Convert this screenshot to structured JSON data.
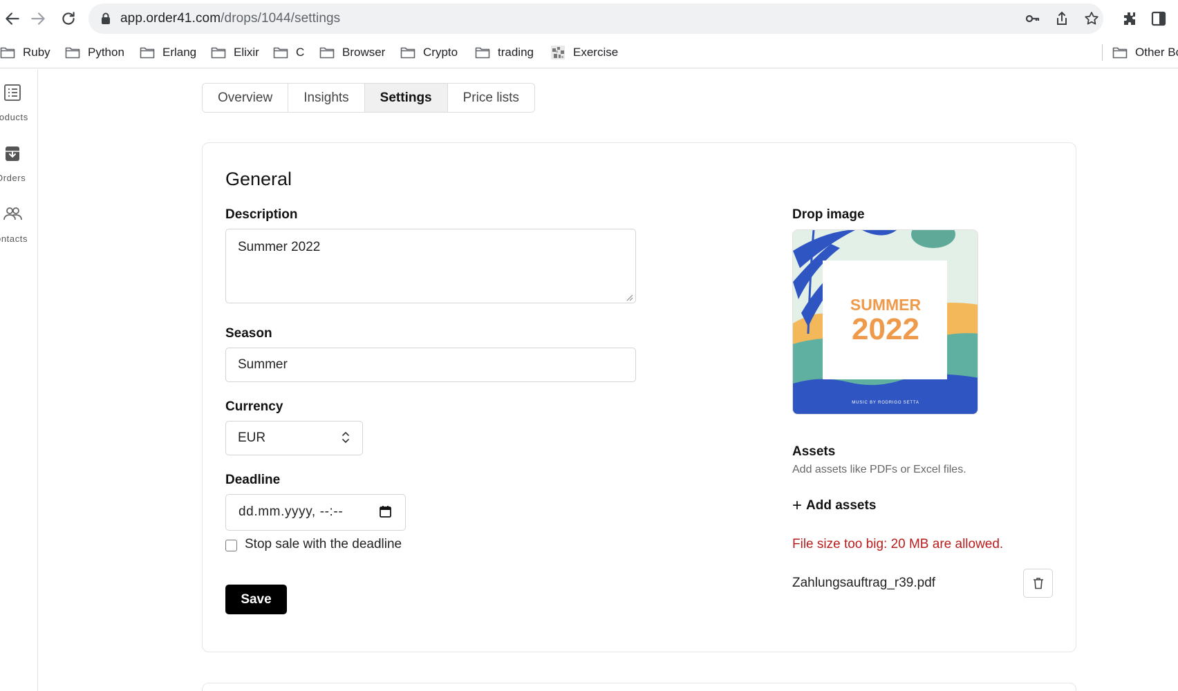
{
  "browser": {
    "url_host": "app.order41.com",
    "url_path": "/drops/1044/settings",
    "bookmarks": [
      {
        "label": "Ruby",
        "icon": "folder-icon"
      },
      {
        "label": "Python",
        "icon": "folder-icon"
      },
      {
        "label": "Erlang",
        "icon": "folder-icon"
      },
      {
        "label": "Elixir",
        "icon": "folder-icon"
      },
      {
        "label": "C",
        "icon": "folder-icon"
      },
      {
        "label": "Browser",
        "icon": "folder-icon"
      },
      {
        "label": "Crypto",
        "icon": "folder-icon"
      },
      {
        "label": "trading",
        "icon": "folder-icon"
      },
      {
        "label": "Exercise",
        "icon": "favicon-icon"
      }
    ],
    "other_bookmarks": "Other Bo"
  },
  "sidebar": {
    "items": [
      {
        "label": "roducts",
        "icon": "list-icon"
      },
      {
        "label": "Orders",
        "icon": "archive-icon"
      },
      {
        "label": "ontacts",
        "icon": "users-icon"
      }
    ]
  },
  "tabs": [
    {
      "label": "Overview",
      "active": false
    },
    {
      "label": "Insights",
      "active": false
    },
    {
      "label": "Settings",
      "active": true
    },
    {
      "label": "Price lists",
      "active": false
    }
  ],
  "general": {
    "title": "General",
    "description": {
      "label": "Description",
      "value": "Summer 2022"
    },
    "season": {
      "label": "Season",
      "value": "Summer"
    },
    "currency": {
      "label": "Currency",
      "value": "EUR"
    },
    "deadline": {
      "label": "Deadline",
      "placeholder": "dd.mm.yyyy, --:--"
    },
    "stop_sale": {
      "label": "Stop sale with the deadline",
      "checked": false
    },
    "save_label": "Save"
  },
  "drop_image": {
    "label": "Drop image",
    "art_line1": "SUMMER",
    "art_line2": "2022",
    "art_caption": "MUSIC BY RODRIGO SETTA"
  },
  "assets": {
    "label": "Assets",
    "hint": "Add assets like PDFs or Excel files.",
    "add_label": "Add assets",
    "error": "File size too big: 20 MB are allowed.",
    "files": [
      {
        "name": "Zahlungsauftrag_r39.pdf"
      }
    ]
  },
  "colors": {
    "error": "#b91c1c",
    "primary_button": "#000000",
    "active_tab_bg": "#f0f0f0",
    "art_blue": "#2f55c2",
    "art_orange": "#ef9a4a",
    "art_mint": "#e3f0e8",
    "art_teal": "#5fb0a0",
    "art_sand": "#f3b85a"
  }
}
